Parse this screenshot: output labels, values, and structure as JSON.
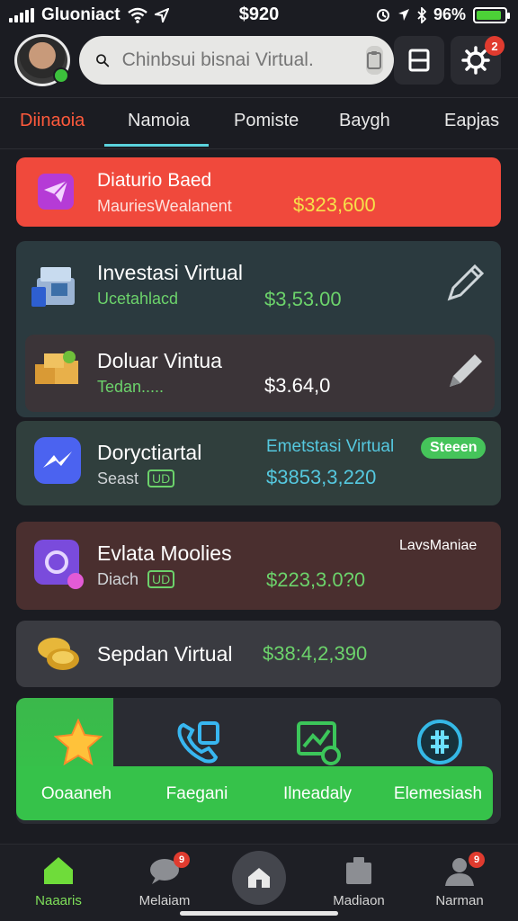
{
  "status_bar": {
    "carrier": "Gluoniact",
    "time": "$920",
    "battery": "96%"
  },
  "header": {
    "search_placeholder": "Chinbsui bisnai Virtual.",
    "gear_badge": "2"
  },
  "tabs": [
    {
      "label": "Diinaoia",
      "active": true
    },
    {
      "label": "Namoia",
      "active": false
    },
    {
      "label": "Pomiste",
      "active": false
    },
    {
      "label": "Baygh",
      "active": false
    },
    {
      "label": "Eapjas",
      "active": false
    }
  ],
  "cards": {
    "promo": {
      "title": "Diaturio Baed",
      "subtitle": "MauriesWealanent",
      "amount": "$323,600",
      "bg": "#f0493c"
    },
    "investasi": {
      "title": "Investasi Virtual",
      "subtitle": "Ucetahlacd",
      "amount": "$3,53.00"
    },
    "doluar": {
      "title": "Doluar Vintua",
      "subtitle": "Tedan.....",
      "amount": "$3.64,0"
    },
    "dorycti": {
      "title": "Doryctiartal",
      "subtitle": "Seast",
      "tag": "UD",
      "highlight": "Emetstasi Virtual",
      "pill": "Steeen",
      "amount": "$3853,3,220"
    },
    "evlata": {
      "title": "Evlata Moolies",
      "subtitle": "Diach",
      "tag": "UD",
      "corner": "LavsManiae",
      "amount": "$223,3.0?0"
    },
    "sepdan": {
      "title": "Sepdan Virtual",
      "amount": "$38:4,2,390"
    }
  },
  "actions": [
    {
      "label": "Ooaaneh",
      "icon": "star-icon"
    },
    {
      "label": "Faegani",
      "icon": "phone-icon"
    },
    {
      "label": "Ilneadaly",
      "icon": "chart-icon"
    },
    {
      "label": "Elemesiash",
      "icon": "currency-icon"
    }
  ],
  "bottom_nav": [
    {
      "label": "Naaaris",
      "active": true,
      "badge": ""
    },
    {
      "label": "Melaiam",
      "active": false,
      "badge": "9"
    },
    {
      "label": "Madiaon",
      "active": false,
      "badge": ""
    },
    {
      "label": "Narman",
      "active": false,
      "badge": "9"
    }
  ],
  "colors": {
    "accent_green": "#36c24a",
    "accent_red": "#f0493c",
    "accent_cyan": "#5ad2dc"
  }
}
